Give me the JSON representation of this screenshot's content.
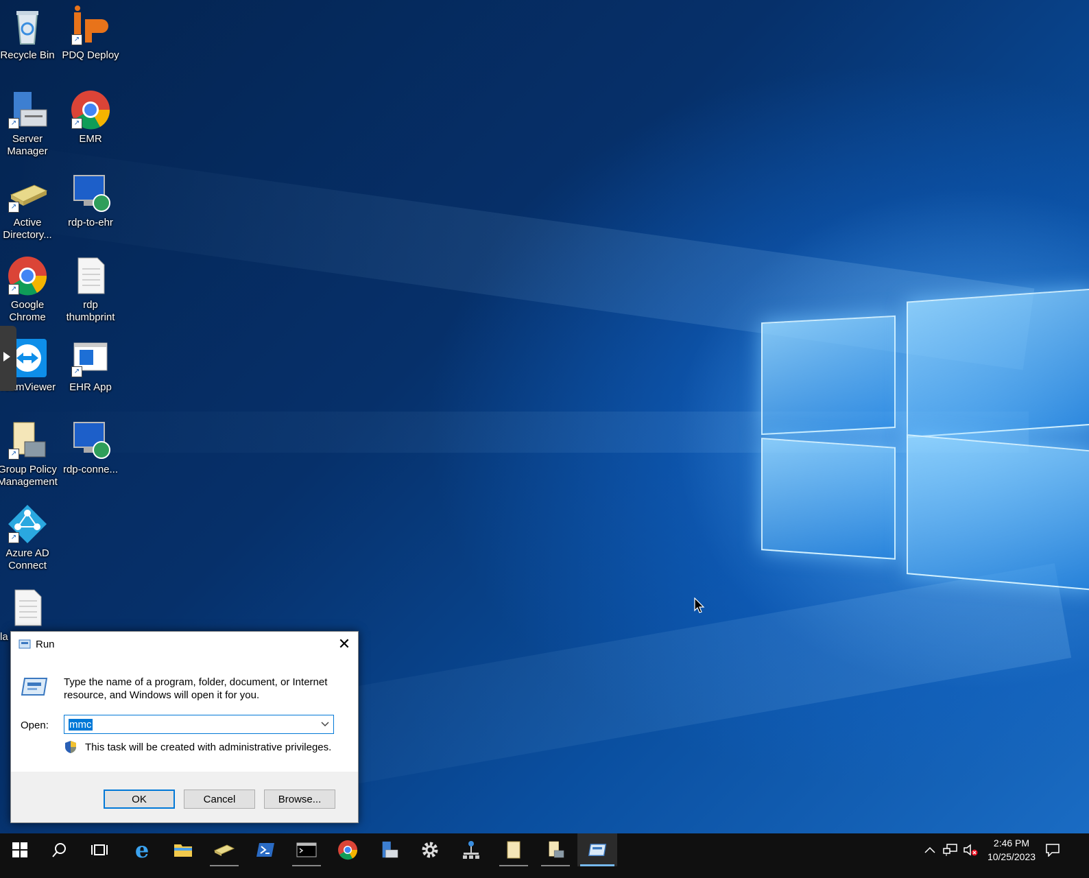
{
  "desktop": {
    "icons": [
      {
        "label": "Recycle Bin",
        "name": "recycle-bin"
      },
      {
        "label": "PDQ Deploy",
        "name": "pdq-deploy"
      },
      {
        "label": "Server Manager",
        "name": "server-manager"
      },
      {
        "label": "EMR",
        "name": "emr"
      },
      {
        "label": "Active Directory...",
        "name": "active-directory"
      },
      {
        "label": "rdp-to-ehr",
        "name": "rdp-to-ehr"
      },
      {
        "label": "Google Chrome",
        "name": "google-chrome"
      },
      {
        "label": "rdp thumbprint",
        "name": "rdp-thumbprint"
      },
      {
        "label": "TeamViewer",
        "name": "teamviewer"
      },
      {
        "label": "EHR App",
        "name": "ehr-app"
      },
      {
        "label": "Group Policy Management",
        "name": "group-policy-management"
      },
      {
        "label": "rdp-conne...",
        "name": "rdp-connection"
      },
      {
        "label": "Azure AD Connect",
        "name": "azure-ad-connect"
      },
      {
        "label": "la",
        "name": "text-file"
      }
    ]
  },
  "run_dialog": {
    "title": "Run",
    "description": "Type the name of a program, folder, document, or Internet resource, and Windows will open it for you.",
    "open_label": "Open:",
    "open_value": "mmc",
    "admin_note": "This task will be created with administrative privileges.",
    "ok_label": "OK",
    "cancel_label": "Cancel",
    "browse_label": "Browse..."
  },
  "taskbar": {
    "time": "2:46 PM",
    "date": "10/25/2023"
  },
  "colors": {
    "accent": "#0078d7",
    "taskbar": "#101010"
  }
}
